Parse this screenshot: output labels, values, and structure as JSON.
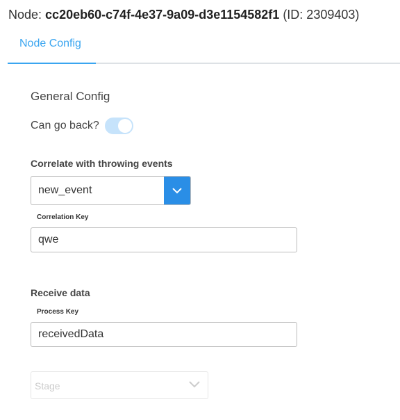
{
  "header": {
    "prefix": "Node: ",
    "node_id": "cc20eb60-c74f-4e37-9a09-d3e1154582f1",
    "id_text": " (ID: 2309403)"
  },
  "tabs": [
    {
      "label": "Node Config",
      "active": true
    }
  ],
  "general": {
    "title": "General Config",
    "can_go_back_label": "Can go back?",
    "can_go_back": true
  },
  "correlate": {
    "title": "Correlate with throwing events",
    "selected": "new_event",
    "key_label": "Correlation Key",
    "key_value": "qwe"
  },
  "receive": {
    "title": "Receive data",
    "process_key_label": "Process Key",
    "process_key_value": "receivedData"
  },
  "stage": {
    "placeholder": "Stage"
  },
  "colors": {
    "accent": "#3aa5f0",
    "button": "#2a8ee6"
  }
}
